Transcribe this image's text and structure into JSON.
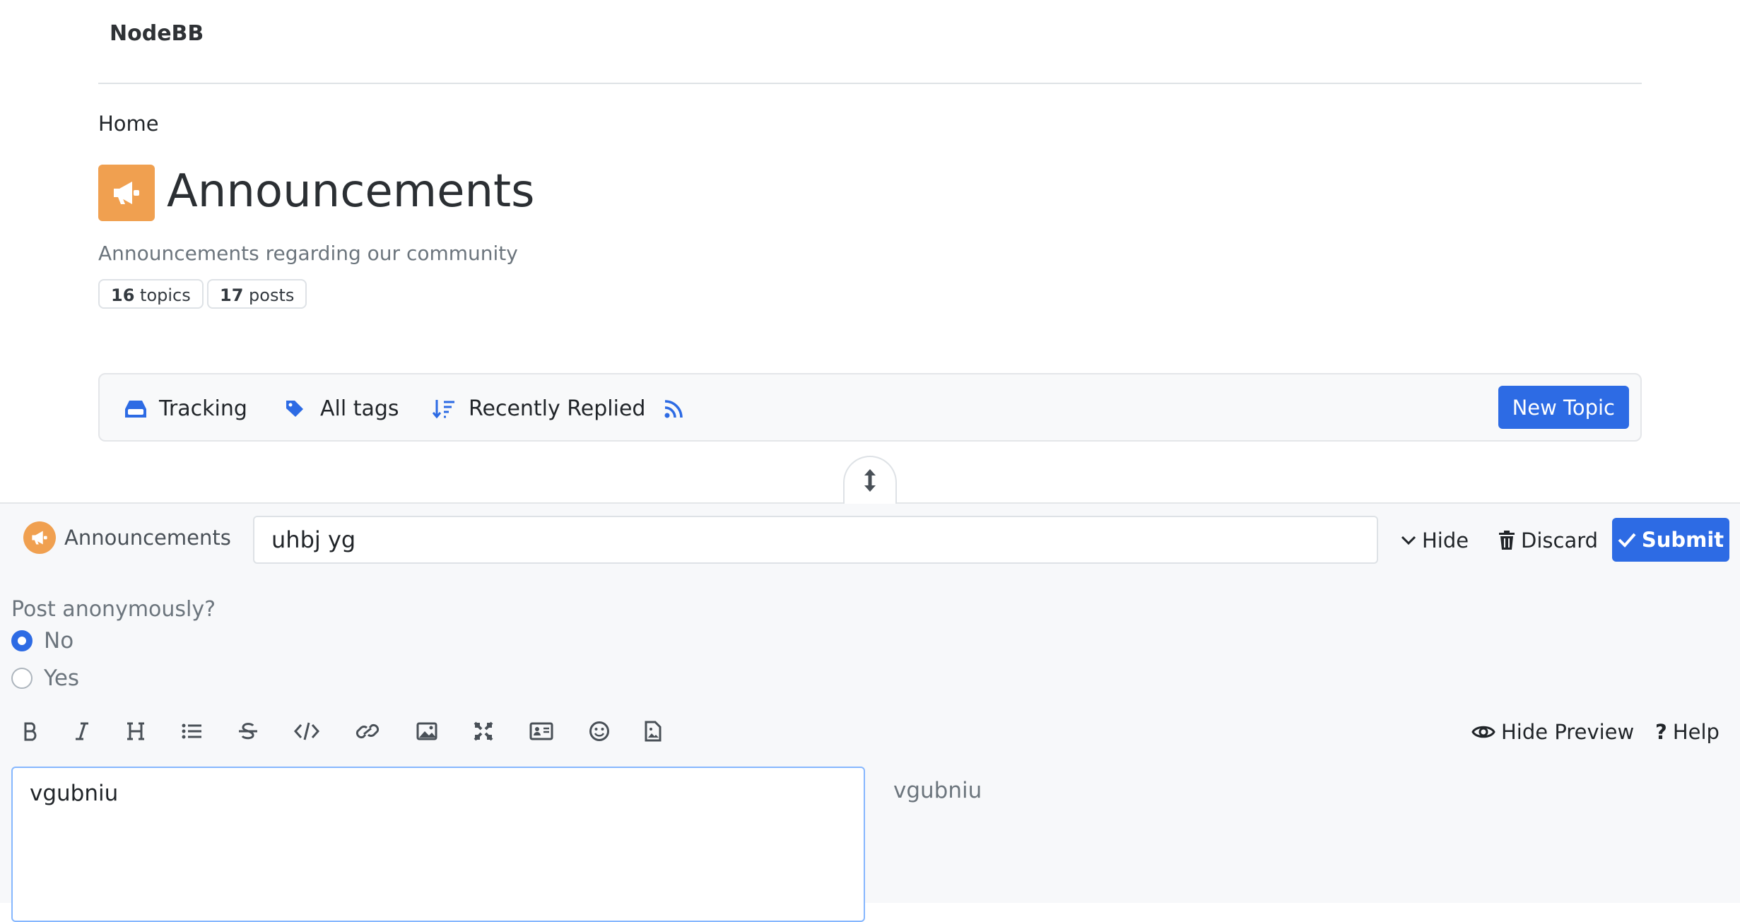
{
  "brand": "NodeBB",
  "breadcrumb": {
    "home": "Home"
  },
  "category": {
    "title": "Announcements",
    "description": "Announcements regarding our community",
    "icon": "bullhorn-icon",
    "color": "#f0a050",
    "stats": {
      "topics_count": "16",
      "topics_label": "topics",
      "posts_count": "17",
      "posts_label": "posts"
    }
  },
  "toolbar": {
    "tracking": "Tracking",
    "all_tags": "All tags",
    "sort": "Recently Replied",
    "new_topic": "New Topic"
  },
  "composer": {
    "category": "Announcements",
    "title_value": "uhbj yg",
    "hide": "Hide",
    "discard": "Discard",
    "submit": "Submit",
    "anonymous_label": "Post anonymously?",
    "anonymous_options": [
      "No",
      "Yes"
    ],
    "anonymous_selected": "No",
    "hide_preview": "Hide Preview",
    "help": "Help",
    "body": "vgubniu",
    "preview": "vgubniu",
    "format_buttons": [
      "bold-icon",
      "italic-icon",
      "heading-icon",
      "list-icon",
      "strikethrough-icon",
      "code-icon",
      "link-icon",
      "image-icon",
      "zen-mode-icon",
      "thumbnail-icon",
      "emoji-icon",
      "upload-file-icon"
    ]
  },
  "colors": {
    "accent": "#2d6be4",
    "category": "#f0a050"
  }
}
